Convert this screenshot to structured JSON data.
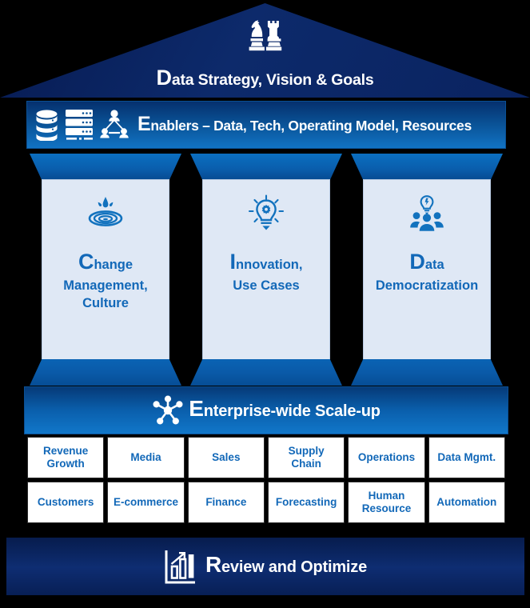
{
  "colors": {
    "navy_dark": "#0b2265",
    "blue_mid": "#0a5296",
    "blue_bright": "#1177c9",
    "pillar_fill": "#dfe8f5",
    "text_blue": "#1268b8",
    "white": "#ffffff",
    "background": "#000000"
  },
  "roof": {
    "icon": "chess-pieces-icon",
    "dropcap": "D",
    "rest": "ata Strategy, Vision & Goals",
    "full_title": "Data Strategy, Vision & Goals"
  },
  "enablers": {
    "icons": [
      "database-stack-icon",
      "server-rack-icon",
      "org-network-icon"
    ],
    "dropcap": "E",
    "rest": "nablers – Data, Tech, Operating Model, Resources",
    "full_title": "Enablers – Data, Tech, Operating Model, Resources"
  },
  "pillars": [
    {
      "icon": "water-droplet-ripple-icon",
      "dropcap": "C",
      "head_rest": "hange",
      "sub": "Management,\nCulture",
      "full_label": "Change Management, Culture"
    },
    {
      "icon": "lightbulb-gear-icon",
      "dropcap": "I",
      "head_rest": "nnovation,",
      "sub": "Use Cases",
      "full_label": "Innovation, Use Cases"
    },
    {
      "icon": "people-lightbulb-icon",
      "dropcap": "D",
      "head_rest": "ata",
      "sub": "Democratization",
      "full_label": "Data Democratization"
    }
  ],
  "scaleup": {
    "icon": "hub-network-icon",
    "dropcap": "E",
    "rest": "nterprise-wide Scale-up",
    "full_title": "Enterprise-wide Scale-up"
  },
  "tiles": {
    "row1": [
      "Revenue\nGrowth",
      "Media",
      "Sales",
      "Supply\nChain",
      "Operations",
      "Data Mgmt."
    ],
    "row2": [
      "Customers",
      "E-commerce",
      "Finance",
      "Forecasting",
      "Human\nResource",
      "Automation"
    ]
  },
  "footer": {
    "icon": "bar-chart-arrow-icon",
    "dropcap": "R",
    "rest": "eview and Optimize",
    "full_title": "Review and Optimize"
  }
}
